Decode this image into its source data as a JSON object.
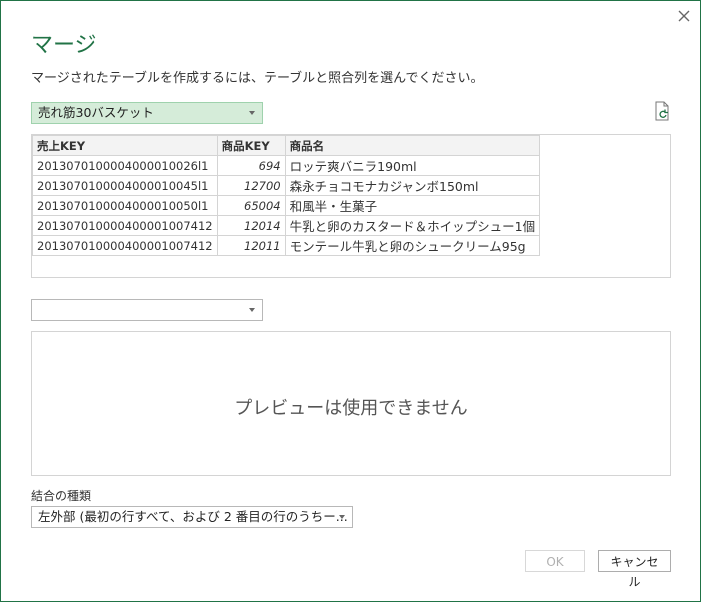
{
  "dialog": {
    "title": "マージ",
    "description": "マージされたテーブルを作成するには、テーブルと照合列を選んでください。",
    "close_icon": "close-icon"
  },
  "top_table": {
    "selected": "売れ筋30バスケット",
    "columns": [
      "売上KEY",
      "商品KEY",
      "商品名"
    ],
    "rows": [
      [
        "2013070100004000010026l1",
        "694",
        "ロッテ爽バニラ190ml"
      ],
      [
        "2013070100004000010045l1",
        "12700",
        "森永チョコモナカジャンボ150ml"
      ],
      [
        "2013070100004000010050l1",
        "65004",
        "和風半・生菓子"
      ],
      [
        "201307010000400001007412",
        "12014",
        "牛乳と卵のカスタード＆ホイップシュー1個"
      ],
      [
        "201307010000400001007412",
        "12011",
        "モンテール牛乳と卵のシュークリーム95g"
      ]
    ]
  },
  "second_table": {
    "selected": "",
    "preview_message": "プレビューは使用できません"
  },
  "join": {
    "label": "結合の種類",
    "selected": "左外部 (最初の行すべて、および 2 番目の行のうちー..."
  },
  "buttons": {
    "ok": "OK",
    "cancel": "キャンセル"
  },
  "colors": {
    "accent": "#217346",
    "selected_dropdown_bg": "#d5ecd9"
  }
}
